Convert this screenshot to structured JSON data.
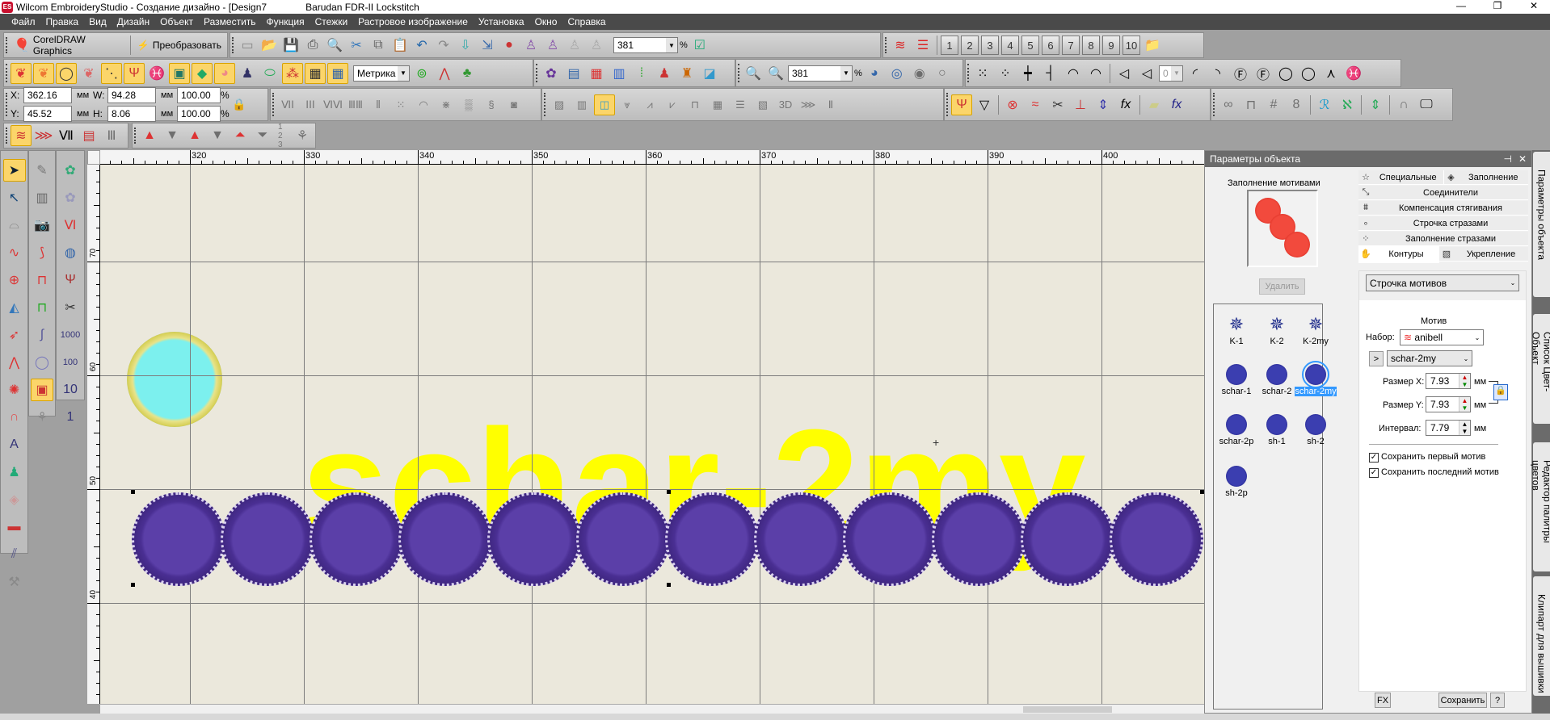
{
  "window": {
    "title": "Wilcom EmbroideryStudio - Создание дизайно - [Design7",
    "machine": "Barudan FDR-II Lockstitch",
    "logo": "ES"
  },
  "menu": [
    "Файл",
    "Правка",
    "Вид",
    "Дизайн",
    "Объект",
    "Разместить",
    "Функция",
    "Стежки",
    "Растровое изображение",
    "Установка",
    "Окно",
    "Справка"
  ],
  "toolbar1": {
    "corel_label": "CorelDRAW Graphics",
    "convert_label": "Преобразовать",
    "file_icons": [
      "new-icon",
      "open-icon",
      "save-icon",
      "print-icon",
      "print-preview-icon",
      "cut-icon",
      "copy-icon",
      "paste-icon",
      "undo-icon",
      "redo-icon",
      "send-machine-icon",
      "export-icon",
      "color-balls-icon",
      "stitch-player-icon",
      "print-stitch-icon",
      "slow-redraw-icon",
      "show-icon"
    ],
    "zoom_value": "381",
    "zoom_unit": "%",
    "number_buttons": [
      "1",
      "2",
      "3",
      "4",
      "5",
      "6",
      "7",
      "8",
      "9",
      "10"
    ]
  },
  "toolbar2": {
    "left_icons": [
      "fill-tatami-icon",
      "fill-satin-icon",
      "outline-icon",
      "fill-dotted-icon",
      "show-stitches-icon",
      "fork-icon",
      "fish-icon",
      "picture-icon",
      "shapes-icon",
      "color-shape-icon",
      "garment-icon",
      "hoop-icon",
      "colors-icon",
      "grid-icon",
      "grid-ruler-icon"
    ],
    "units_value": "Метрика",
    "zoom_value": "381",
    "zoom_unit": "%",
    "align_labels": [
      "0"
    ]
  },
  "coords": {
    "x_label": "X:",
    "x": "362.16",
    "y_label": "Y:",
    "y": "45.52",
    "w_label": "W:",
    "w": "94.28",
    "h_label": "H:",
    "h": "8.06",
    "unit": "мм",
    "sx": "100.00",
    "sy": "100.00",
    "pct": "%"
  },
  "toolbar4": {
    "seq_label": "1 2 3"
  },
  "rulers": {
    "h": [
      "320",
      "330",
      "340",
      "350",
      "360",
      "370",
      "380",
      "390",
      "400"
    ],
    "v": [
      "70",
      "60",
      "50",
      "40"
    ]
  },
  "canvas": {
    "text": "schar-2my",
    "motif_count": 12,
    "colors": {
      "text": "#ffff00",
      "purple": "#4a2f93",
      "cyan": "#7cf0ee",
      "background": "#ebe8dc"
    }
  },
  "panel": {
    "title": "Параметры объекта",
    "pin": "⊣",
    "close": "✕",
    "preview_label": "Заполнение мотивами",
    "delete_label": "Удалить",
    "motifs": [
      {
        "name": "K-1",
        "type": "k"
      },
      {
        "name": "K-2",
        "type": "k"
      },
      {
        "name": "K-2my",
        "type": "k"
      },
      {
        "name": "schar-1",
        "type": "c"
      },
      {
        "name": "schar-2",
        "type": "c"
      },
      {
        "name": "schar-2my",
        "type": "c",
        "selected": true
      },
      {
        "name": "schar-2p",
        "type": "c"
      },
      {
        "name": "sh-1",
        "type": "c"
      },
      {
        "name": "sh-2",
        "type": "c"
      },
      {
        "name": "sh-2p",
        "type": "c"
      }
    ],
    "tabs": {
      "special": "Специальные",
      "fill": "Заполнение",
      "connectors": "Соединители",
      "pull_comp": "Компенсация стягивания",
      "bling_run": "Строчка стразами",
      "bling_fill": "Заполнение стразами",
      "outlines": "Контуры",
      "underlay": "Укрепление"
    },
    "outline_type": "Строчка мотивов",
    "motif_heading": "Мотив",
    "set_label": "Набор:",
    "set_value": "anibell",
    "next_label": ">",
    "motif_value": "schar-2my",
    "size_x_label": "Размер X:",
    "size_x": "7.93",
    "size_y_label": "Размер Y:",
    "size_y": "7.93",
    "interval_label": "Интервал:",
    "interval": "7.79",
    "unit": "мм",
    "keep_first": {
      "label": "Сохранить первый мотив",
      "checked": true
    },
    "keep_last": {
      "label": "Сохранить последний мотив",
      "checked": true
    },
    "fx_label": "FX",
    "save_label": "Сохранить",
    "help_label": "?"
  },
  "side_tabs": [
    "Параметры объекта",
    "Список Цвет-Объект",
    "Редактор палитры цветов",
    "Клипарт для вышивки"
  ]
}
